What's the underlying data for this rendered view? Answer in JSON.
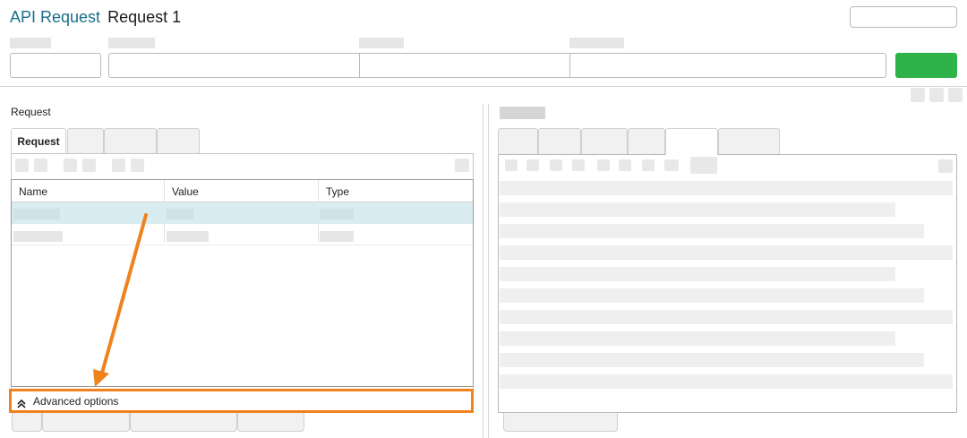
{
  "header": {
    "app_title": "API Request",
    "request_name": "Request 1",
    "accent_color": "#1a6f8a",
    "send_button_color": "#2db34a"
  },
  "left_panel": {
    "section_label": "Request",
    "tabs": [
      {
        "label": "Request",
        "active": true
      },
      {
        "label": "",
        "active": false
      },
      {
        "label": "",
        "active": false
      },
      {
        "label": "",
        "active": false
      }
    ],
    "table": {
      "columns": [
        "Name",
        "Value",
        "Type"
      ],
      "selected_row_color": "#d9edf0"
    },
    "advanced_options_label": "Advanced options",
    "advanced_icon": "double-chevron-up-icon",
    "highlight_color": "#f0821e"
  }
}
